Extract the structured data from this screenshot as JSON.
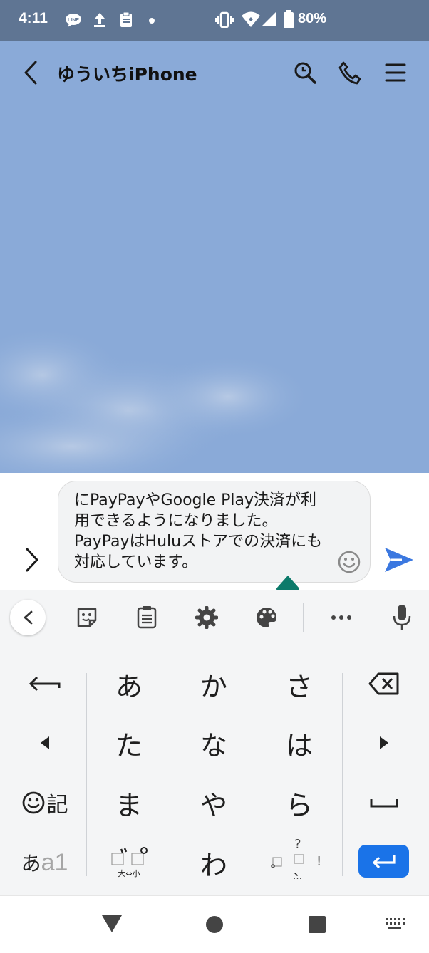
{
  "status_bar": {
    "time": "4:11",
    "battery": "80%",
    "icons": [
      "line-notification-icon",
      "upload-icon",
      "clipboard-icon",
      "dot-icon",
      "vibrate-icon",
      "wifi-icon",
      "signal-icon",
      "battery-icon"
    ]
  },
  "header": {
    "title": "ゆういちiPhone",
    "icons": [
      "back-icon",
      "search-icon",
      "phone-icon",
      "menu-icon"
    ]
  },
  "composer": {
    "text": "にPayPayやGoogle Play決済が利用できるようになりました。PayPayはHuluストアでの決済にも対応しています。"
  },
  "keyboard": {
    "keys": {
      "a": "あ",
      "ka": "か",
      "sa": "さ",
      "ta": "た",
      "na": "な",
      "ha": "は",
      "ma": "ま",
      "ya": "や",
      "ra": "ら",
      "wa": "わ",
      "emoji_ki": "記",
      "mode_a": "あ",
      "mode_a1": "a1",
      "dakuten_small": "大⇔小",
      "punct_q": "?",
      "punct_comma": "、",
      "punct_excl": "!",
      "punct_more": "…"
    }
  },
  "colors": {
    "status_bar": "#5f7593",
    "chat_background": "#8aaad8",
    "send": "#3b78e0",
    "enter_key": "#1a73e8",
    "cursor_handle": "#0c7a6a"
  }
}
